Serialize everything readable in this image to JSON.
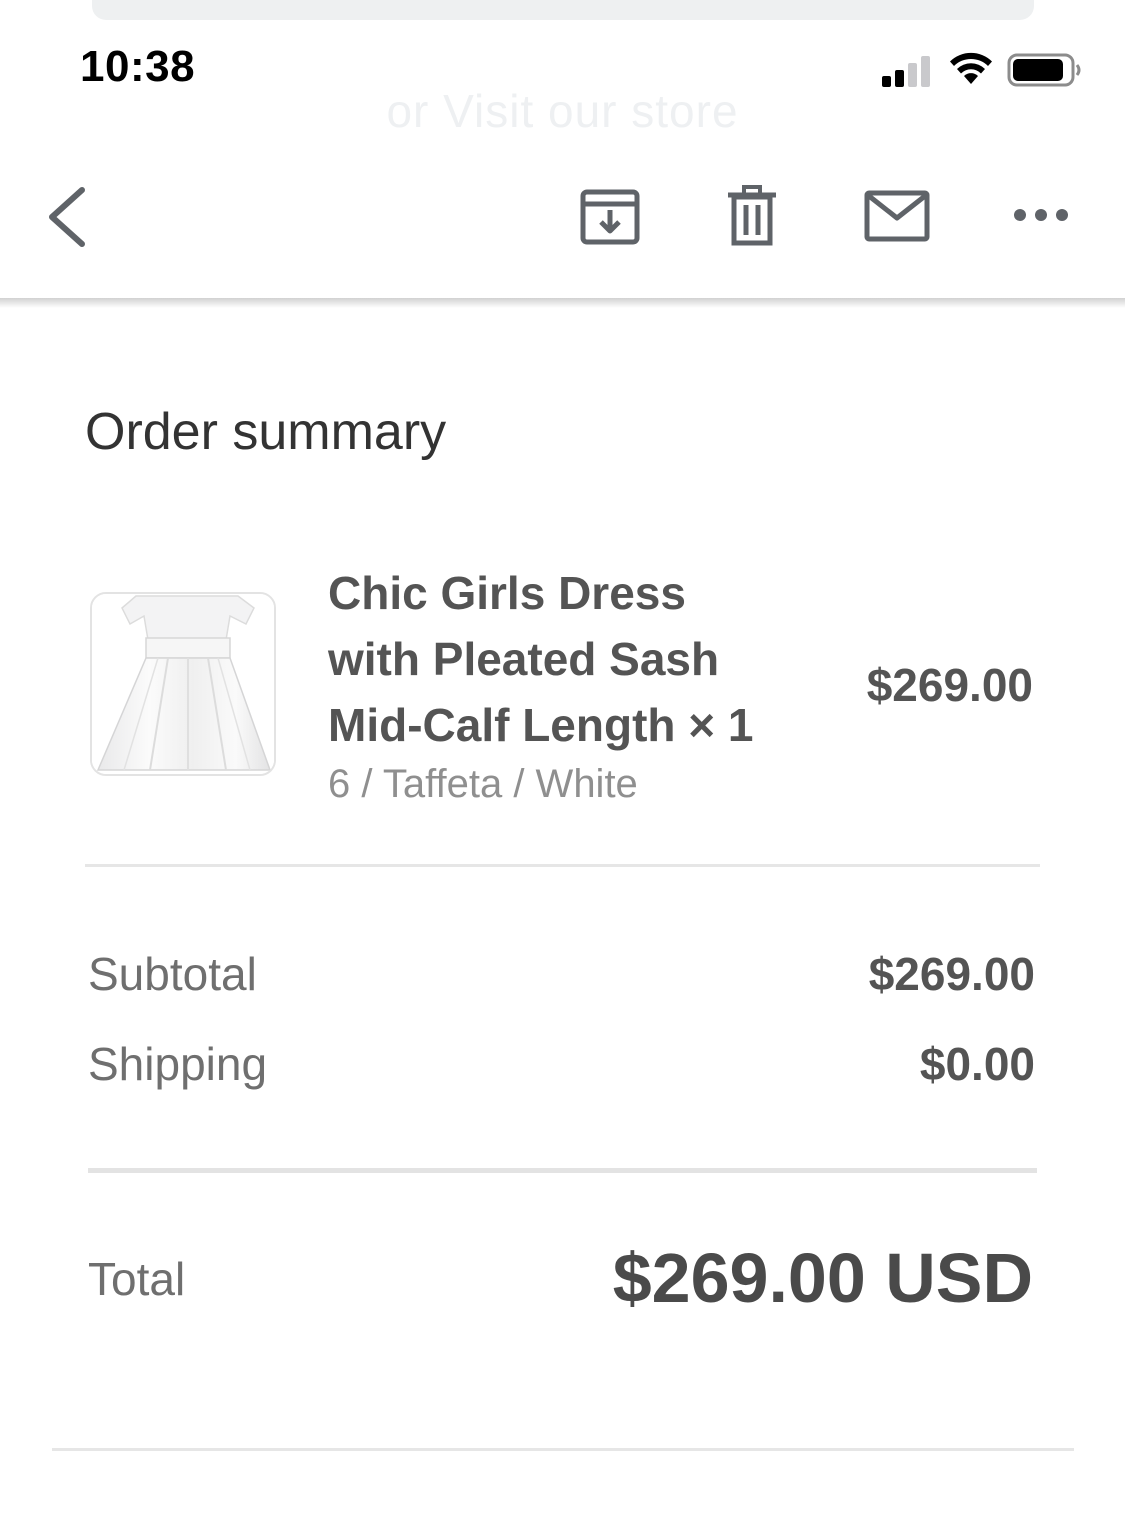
{
  "status_bar": {
    "time": "10:38"
  },
  "background_remnant": {
    "link_text": "or Visit our store"
  },
  "toolbar": {
    "icons": [
      "back-icon",
      "archive-icon",
      "trash-icon",
      "mail-icon",
      "more-icon"
    ]
  },
  "order_summary": {
    "title": "Order summary",
    "item": {
      "name_line1": "Chic Girls Dress",
      "name_line2": "with Pleated Sash",
      "name_line3": "Mid-Calf Length × 1",
      "variant": "6 / Taffeta / White",
      "price": "$269.00"
    },
    "subtotal_label": "Subtotal",
    "subtotal_value": "$269.00",
    "shipping_label": "Shipping",
    "shipping_value": "$0.00",
    "total_label": "Total",
    "total_value": "$269.00 USD"
  },
  "colors": {
    "text_dark": "#545454",
    "text_muted": "#8f8f8f",
    "icon_gray": "#5f6368"
  }
}
